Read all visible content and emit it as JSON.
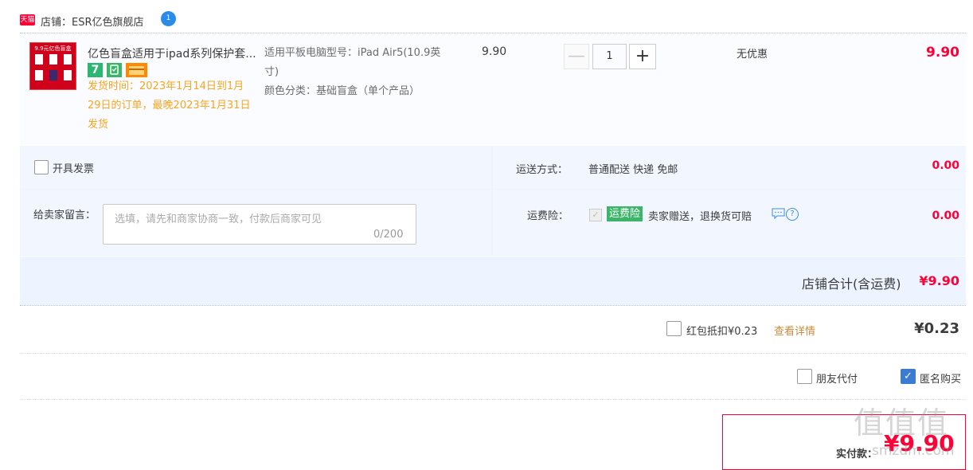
{
  "shop": {
    "badge": "天猫",
    "name": "店铺：ESR亿色旗舰店",
    "chat_badge": "1"
  },
  "item": {
    "thumb_text": "9.9元亿色盲盒",
    "title": "亿色盲盒适用于ipad系列保护套...",
    "badge_seven": "7",
    "ship_note": "发货时间：2023年1月14日到1月29日的订单，最晚2023年1月31日发货",
    "sku_model": "适用平板电脑型号：iPad Air5(10.9英寸)",
    "sku_color": "颜色分类：基础盲盒（单个产品）",
    "price": "9.90",
    "qty_minus": "—",
    "quantity": "1",
    "qty_plus": "+",
    "discount": "无优惠",
    "subtotal": "9.90"
  },
  "options": {
    "invoice_label": "开具发票",
    "shipping_label": "运送方式：",
    "shipping_value": "普通配送 快递 免邮",
    "shipping_fee": "0.00",
    "message_label": "给卖家留言：",
    "message_placeholder": "选填，请先和商家协商一致，付款后商家可见",
    "message_count": "0/200",
    "insurance_label": "运费险：",
    "insurance_check": "✓",
    "insurance_badge": "运费险",
    "insurance_text": "卖家赠送，退换货可赔",
    "insurance_fee": "0.00",
    "shop_total_label": "店铺合计(含运费)",
    "shop_total_value": "¥9.90"
  },
  "redpacket": {
    "label": "红包抵扣¥0.23",
    "link": "查看详情",
    "value": "¥0.23"
  },
  "pay_options": {
    "friend_pay": "朋友代付",
    "anonymous": "匿名购买",
    "anon_check": "✓"
  },
  "pay": {
    "label": "实付款：",
    "value": "¥9.90"
  },
  "watermark": {
    "glyphs": "值值值",
    "site": "smzdm.com"
  },
  "colors": {
    "accent_red": "#ff0036",
    "ship_note_orange": "#f5a623",
    "insurance_green": "#3bb56a",
    "panel_blue": "#eef4ff"
  }
}
